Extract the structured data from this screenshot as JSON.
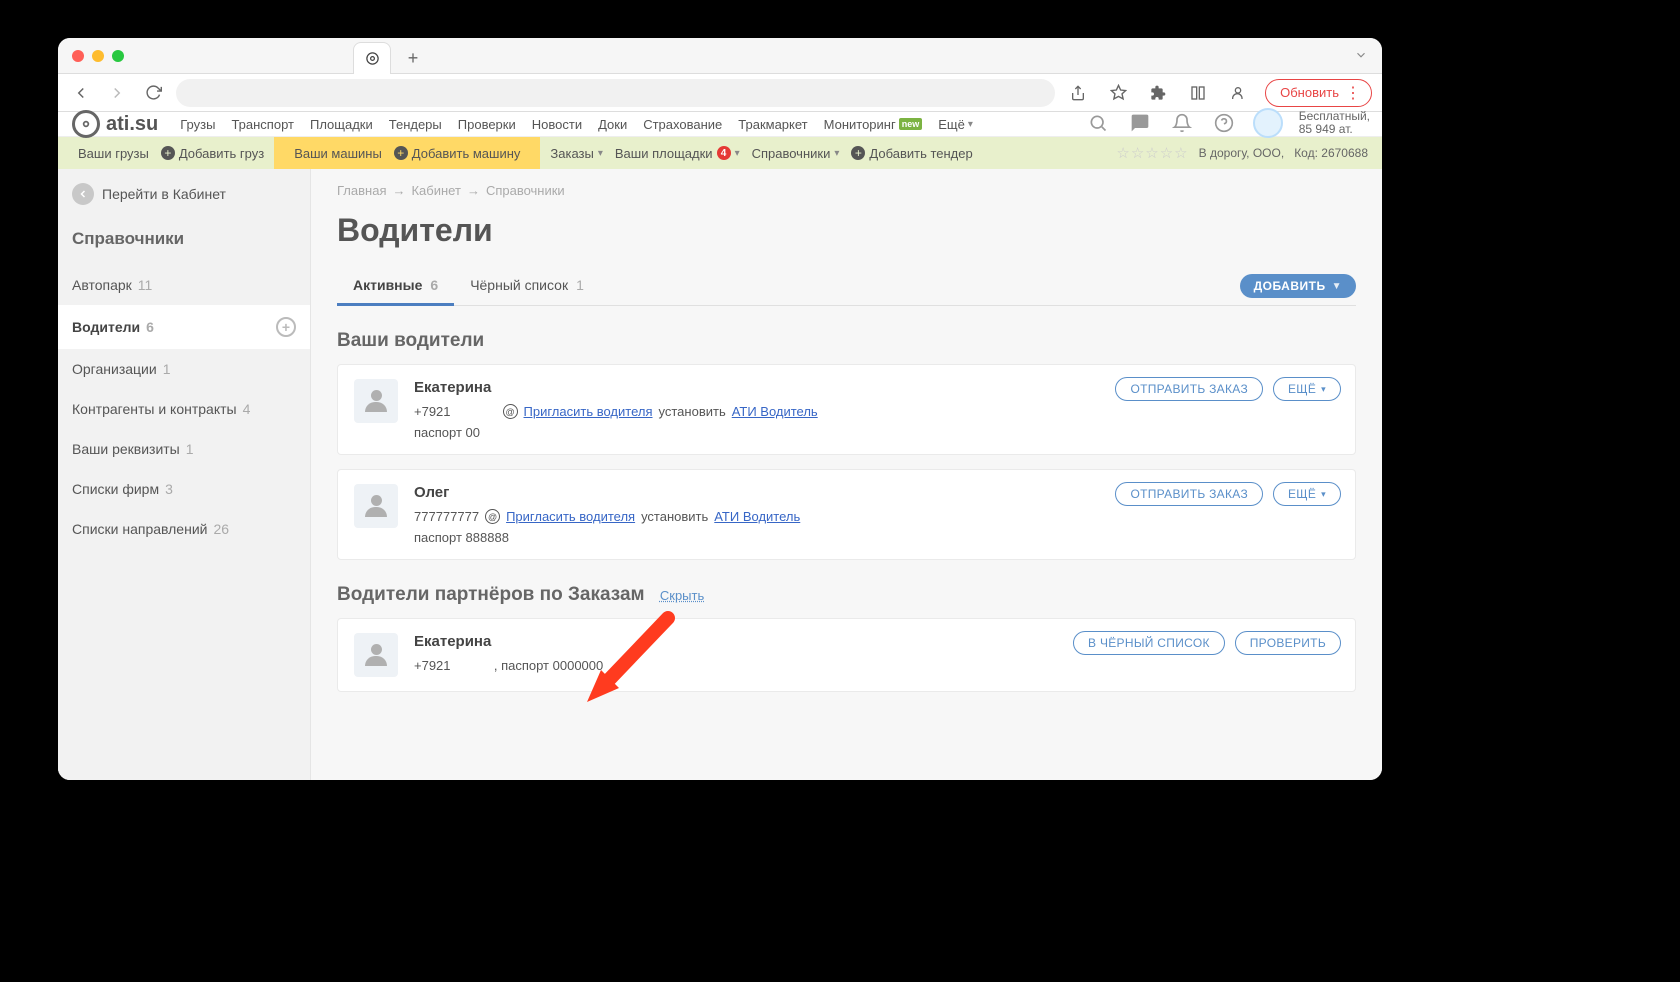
{
  "browser": {
    "update_label": "Обновить"
  },
  "header": {
    "logo_text": "ati.su",
    "nav": [
      "Грузы",
      "Транспорт",
      "Площадки",
      "Тендеры",
      "Проверки",
      "Новости",
      "Доки",
      "Страхование",
      "Тракмаркет",
      "Мониторинг"
    ],
    "more": "Ещё",
    "status_line1": "Бесплатный,",
    "status_line2": "85 949 ат."
  },
  "subnav": {
    "your_cargo": "Ваши грузы",
    "add_cargo": "Добавить груз",
    "your_vehicles": "Ваши машины",
    "add_vehicle": "Добавить машину",
    "orders": "Заказы",
    "your_sites": "Ваши площадки",
    "sites_badge": "4",
    "refs": "Справочники",
    "add_tender": "Добавить тендер",
    "company": "В дорогу, ООО,",
    "code_label": "Код:",
    "code": "2670688"
  },
  "sidebar": {
    "back": "Перейти в Кабинет",
    "title": "Справочники",
    "items": [
      {
        "label": "Автопарк",
        "count": "11"
      },
      {
        "label": "Водители",
        "count": "6"
      },
      {
        "label": "Организации",
        "count": "1"
      },
      {
        "label": "Контрагенты и контракты",
        "count": "4"
      },
      {
        "label": "Ваши реквизиты",
        "count": "1"
      },
      {
        "label": "Списки фирм",
        "count": "3"
      },
      {
        "label": "Списки направлений",
        "count": "26"
      }
    ]
  },
  "breadcrumbs": {
    "home": "Главная",
    "cabinet": "Кабинет",
    "refs": "Справочники"
  },
  "page": {
    "title": "Водители",
    "tabs": {
      "active": "Активные",
      "active_count": "6",
      "black": "Чёрный список",
      "black_count": "1"
    },
    "add_button": "ДОБАВИТЬ",
    "section_your": "Ваши водители",
    "section_partners": "Водители партнёров по Заказам",
    "hide": "Скрыть",
    "btn_send_order": "ОТПРАВИТЬ ЗАКАЗ",
    "btn_more": "ЕЩЁ",
    "btn_blacklist": "В ЧЁРНЫЙ СПИСОК",
    "btn_check": "ПРОВЕРИТЬ",
    "invite_text": "Пригласить водителя",
    "install_text": "установить",
    "app_name": "АТИ Водитель"
  },
  "drivers_own": [
    {
      "name": "Екатерина",
      "phone": "+7921",
      "passport": "паспорт 00"
    },
    {
      "name": "Олег",
      "phone": "777777777",
      "passport": "паспорт 888888"
    }
  ],
  "drivers_partner": [
    {
      "name": "Екатерина",
      "details": "+7921            , паспорт 0000000"
    }
  ]
}
